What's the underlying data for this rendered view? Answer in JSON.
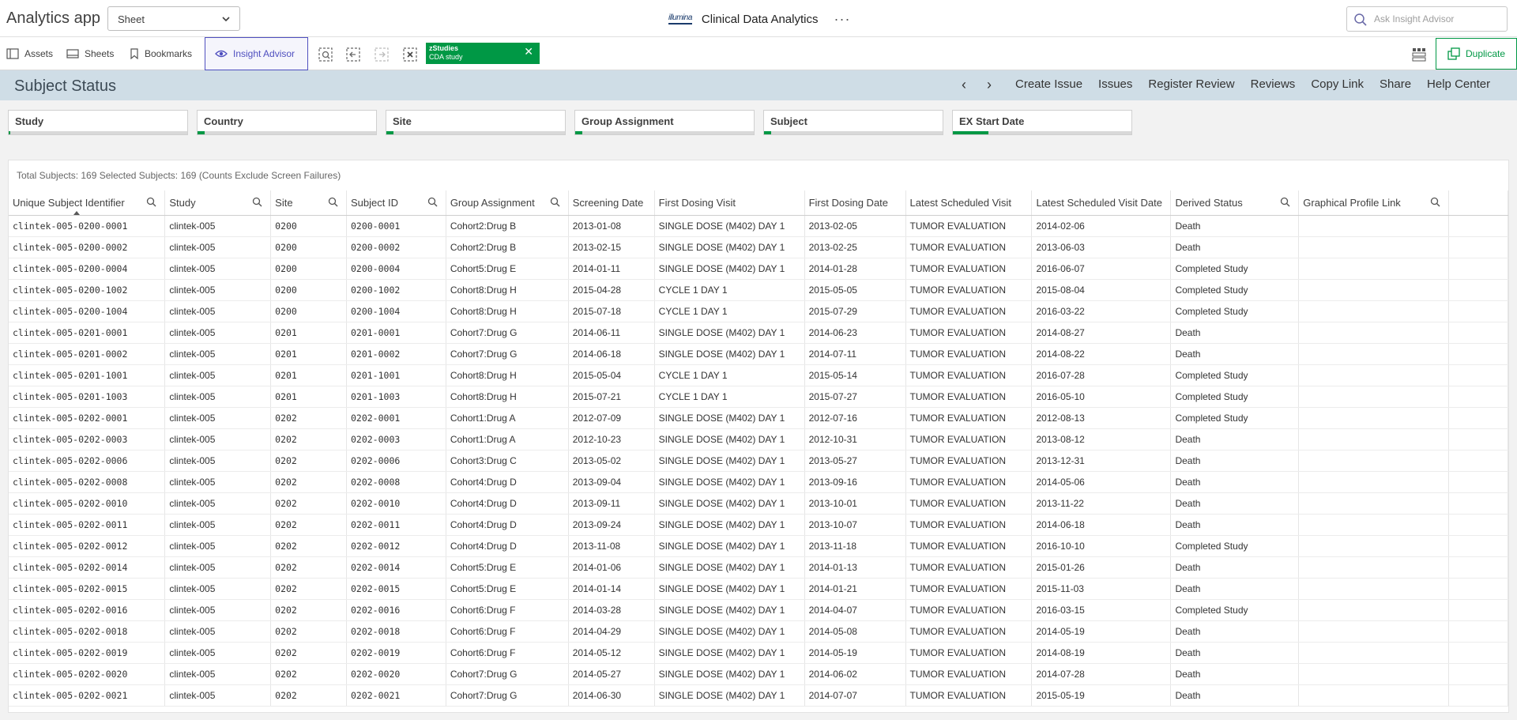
{
  "app": {
    "title": "Analytics app"
  },
  "sheet_select": {
    "value": "Sheet"
  },
  "brand": {
    "logo": "illumina",
    "name": "Clinical Data Analytics",
    "more": "···"
  },
  "advisor": {
    "placeholder": "Ask Insight Advisor"
  },
  "toolbar": {
    "assets": "Assets",
    "sheets": "Sheets",
    "bookmarks": "Bookmarks",
    "insight_advisor": "Insight Advisor",
    "duplicate": "Duplicate"
  },
  "selection_chip": {
    "field": "zStudies",
    "value": "CDA study"
  },
  "band": {
    "title": "Subject Status",
    "links": [
      "Create Issue",
      "Issues",
      "Register Review",
      "Reviews",
      "Copy Link",
      "Share",
      "Help Center"
    ]
  },
  "filters": [
    {
      "label": "Study",
      "fill": 0.01
    },
    {
      "label": "Country",
      "fill": 0.04
    },
    {
      "label": "Site",
      "fill": 0.04
    },
    {
      "label": "Group Assignment",
      "fill": 0.04
    },
    {
      "label": "Subject",
      "fill": 0.04
    },
    {
      "label": "EX Start Date",
      "fill": 0.2
    }
  ],
  "table": {
    "totals": "Total Subjects: 169 Selected Subjects: 169 (Counts Exclude Screen Failures)",
    "columns": [
      "Unique Subject Identifier",
      "Study",
      "Site",
      "Subject ID",
      "Group Assignment",
      "Screening Date",
      "First Dosing Visit",
      "First Dosing Date",
      "Latest Scheduled Visit",
      "Latest Scheduled Visit Date",
      "Derived Status",
      "Graphical Profile Link"
    ],
    "rows": [
      [
        "clintek-005-0200-0001",
        "clintek-005",
        "0200",
        "0200-0001",
        "Cohort2:Drug B",
        "2013-01-08",
        "SINGLE DOSE (M402) DAY 1",
        "2013-02-05",
        "TUMOR EVALUATION",
        "2014-02-06",
        "Death",
        ""
      ],
      [
        "clintek-005-0200-0002",
        "clintek-005",
        "0200",
        "0200-0002",
        "Cohort2:Drug B",
        "2013-02-15",
        "SINGLE DOSE (M402) DAY 1",
        "2013-02-25",
        "TUMOR EVALUATION",
        "2013-06-03",
        "Death",
        ""
      ],
      [
        "clintek-005-0200-0004",
        "clintek-005",
        "0200",
        "0200-0004",
        "Cohort5:Drug E",
        "2014-01-11",
        "SINGLE DOSE (M402) DAY 1",
        "2014-01-28",
        "TUMOR EVALUATION",
        "2016-06-07",
        "Completed Study",
        ""
      ],
      [
        "clintek-005-0200-1002",
        "clintek-005",
        "0200",
        "0200-1002",
        "Cohort8:Drug H",
        "2015-04-28",
        "CYCLE 1 DAY 1",
        "2015-05-05",
        "TUMOR EVALUATION",
        "2015-08-04",
        "Completed Study",
        ""
      ],
      [
        "clintek-005-0200-1004",
        "clintek-005",
        "0200",
        "0200-1004",
        "Cohort8:Drug H",
        "2015-07-18",
        "CYCLE 1 DAY 1",
        "2015-07-29",
        "TUMOR EVALUATION",
        "2016-03-22",
        "Completed Study",
        ""
      ],
      [
        "clintek-005-0201-0001",
        "clintek-005",
        "0201",
        "0201-0001",
        "Cohort7:Drug G",
        "2014-06-11",
        "SINGLE DOSE (M402) DAY 1",
        "2014-06-23",
        "TUMOR EVALUATION",
        "2014-08-27",
        "Death",
        ""
      ],
      [
        "clintek-005-0201-0002",
        "clintek-005",
        "0201",
        "0201-0002",
        "Cohort7:Drug G",
        "2014-06-18",
        "SINGLE DOSE (M402) DAY 1",
        "2014-07-11",
        "TUMOR EVALUATION",
        "2014-08-22",
        "Death",
        ""
      ],
      [
        "clintek-005-0201-1001",
        "clintek-005",
        "0201",
        "0201-1001",
        "Cohort8:Drug H",
        "2015-05-04",
        "CYCLE 1 DAY 1",
        "2015-05-14",
        "TUMOR EVALUATION",
        "2016-07-28",
        "Completed Study",
        ""
      ],
      [
        "clintek-005-0201-1003",
        "clintek-005",
        "0201",
        "0201-1003",
        "Cohort8:Drug H",
        "2015-07-21",
        "CYCLE 1 DAY 1",
        "2015-07-27",
        "TUMOR EVALUATION",
        "2016-05-10",
        "Completed Study",
        ""
      ],
      [
        "clintek-005-0202-0001",
        "clintek-005",
        "0202",
        "0202-0001",
        "Cohort1:Drug A",
        "2012-07-09",
        "SINGLE DOSE (M402) DAY 1",
        "2012-07-16",
        "TUMOR EVALUATION",
        "2012-08-13",
        "Completed Study",
        ""
      ],
      [
        "clintek-005-0202-0003",
        "clintek-005",
        "0202",
        "0202-0003",
        "Cohort1:Drug A",
        "2012-10-23",
        "SINGLE DOSE (M402) DAY 1",
        "2012-10-31",
        "TUMOR EVALUATION",
        "2013-08-12",
        "Death",
        ""
      ],
      [
        "clintek-005-0202-0006",
        "clintek-005",
        "0202",
        "0202-0006",
        "Cohort3:Drug C",
        "2013-05-02",
        "SINGLE DOSE (M402) DAY 1",
        "2013-05-27",
        "TUMOR EVALUATION",
        "2013-12-31",
        "Death",
        ""
      ],
      [
        "clintek-005-0202-0008",
        "clintek-005",
        "0202",
        "0202-0008",
        "Cohort4:Drug D",
        "2013-09-04",
        "SINGLE DOSE (M402) DAY 1",
        "2013-09-16",
        "TUMOR EVALUATION",
        "2014-05-06",
        "Death",
        ""
      ],
      [
        "clintek-005-0202-0010",
        "clintek-005",
        "0202",
        "0202-0010",
        "Cohort4:Drug D",
        "2013-09-11",
        "SINGLE DOSE (M402) DAY 1",
        "2013-10-01",
        "TUMOR EVALUATION",
        "2013-11-22",
        "Death",
        ""
      ],
      [
        "clintek-005-0202-0011",
        "clintek-005",
        "0202",
        "0202-0011",
        "Cohort4:Drug D",
        "2013-09-24",
        "SINGLE DOSE (M402) DAY 1",
        "2013-10-07",
        "TUMOR EVALUATION",
        "2014-06-18",
        "Death",
        ""
      ],
      [
        "clintek-005-0202-0012",
        "clintek-005",
        "0202",
        "0202-0012",
        "Cohort4:Drug D",
        "2013-11-08",
        "SINGLE DOSE (M402) DAY 1",
        "2013-11-18",
        "TUMOR EVALUATION",
        "2016-10-10",
        "Completed Study",
        ""
      ],
      [
        "clintek-005-0202-0014",
        "clintek-005",
        "0202",
        "0202-0014",
        "Cohort5:Drug E",
        "2014-01-06",
        "SINGLE DOSE (M402) DAY 1",
        "2014-01-13",
        "TUMOR EVALUATION",
        "2015-01-26",
        "Death",
        ""
      ],
      [
        "clintek-005-0202-0015",
        "clintek-005",
        "0202",
        "0202-0015",
        "Cohort5:Drug E",
        "2014-01-14",
        "SINGLE DOSE (M402) DAY 1",
        "2014-01-21",
        "TUMOR EVALUATION",
        "2015-11-03",
        "Death",
        ""
      ],
      [
        "clintek-005-0202-0016",
        "clintek-005",
        "0202",
        "0202-0016",
        "Cohort6:Drug F",
        "2014-03-28",
        "SINGLE DOSE (M402) DAY 1",
        "2014-04-07",
        "TUMOR EVALUATION",
        "2016-03-15",
        "Completed Study",
        ""
      ],
      [
        "clintek-005-0202-0018",
        "clintek-005",
        "0202",
        "0202-0018",
        "Cohort6:Drug F",
        "2014-04-29",
        "SINGLE DOSE (M402) DAY 1",
        "2014-05-08",
        "TUMOR EVALUATION",
        "2014-05-19",
        "Death",
        ""
      ],
      [
        "clintek-005-0202-0019",
        "clintek-005",
        "0202",
        "0202-0019",
        "Cohort6:Drug F",
        "2014-05-12",
        "SINGLE DOSE (M402) DAY 1",
        "2014-05-19",
        "TUMOR EVALUATION",
        "2014-08-19",
        "Death",
        ""
      ],
      [
        "clintek-005-0202-0020",
        "clintek-005",
        "0202",
        "0202-0020",
        "Cohort7:Drug G",
        "2014-05-27",
        "SINGLE DOSE (M402) DAY 1",
        "2014-06-02",
        "TUMOR EVALUATION",
        "2014-07-28",
        "Death",
        ""
      ],
      [
        "clintek-005-0202-0021",
        "clintek-005",
        "0202",
        "0202-0021",
        "Cohort7:Drug G",
        "2014-06-30",
        "SINGLE DOSE (M402) DAY 1",
        "2014-07-07",
        "TUMOR EVALUATION",
        "2015-05-19",
        "Death",
        ""
      ]
    ]
  },
  "colors": {
    "accent": "#009845",
    "insight": "#4f4fbf",
    "band": "#cfdde6"
  }
}
